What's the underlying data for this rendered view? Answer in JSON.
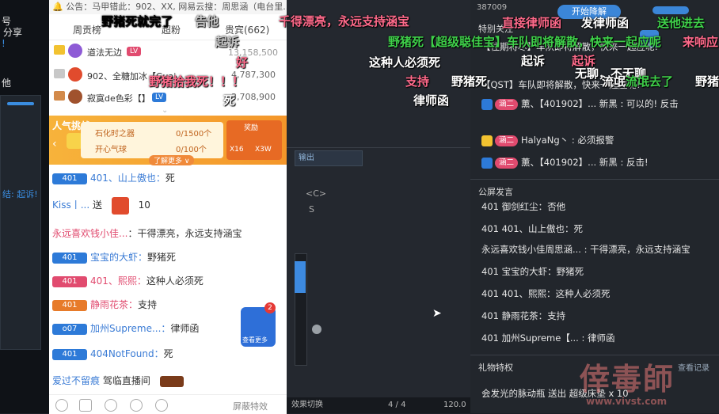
{
  "left_strip": {
    "texts": [
      "号",
      "分享",
      "他",
      "!"
    ],
    "tags": [
      "结: 起诉!"
    ]
  },
  "chat": {
    "notice": "公告：马甲错此：902、XX, 网易云搜：周思涵（电台里...",
    "tabs": [
      "周贡榜",
      "超粉",
      "贵宾(662)"
    ],
    "ranking": [
      {
        "name": "道法无边",
        "value": ""
      },
      {
        "name": "902、全糖加冰【Guai...",
        "value": "4,787,300"
      },
      {
        "name": "寂寞de色彩【】",
        "value": "3,708,900"
      }
    ],
    "first_value": "13,158,500",
    "banner": {
      "title": "人气挑战",
      "row1": "石化时之器",
      "row1_val": "0/1500个",
      "row2": "开心气球",
      "row2_val": "0/100个",
      "more": "了解更多 ∨",
      "reward": "奖励",
      "x1": "X16",
      "x2": "X3W"
    },
    "lines": [
      {
        "level": "401",
        "name": "401、山上傲也：",
        "text": "死"
      },
      {
        "name": "Kiss丨...",
        "text": "送",
        "extra": "10"
      },
      {
        "name": "永远喜欢钱小佳...",
        "text": "：干得漂亮，永远支持涵宝"
      },
      {
        "level": "401",
        "name": "宝宝的大虾：",
        "text": "野猪死"
      },
      {
        "level": "401",
        "name": "401、熙熙：",
        "text": "这种人必须死"
      },
      {
        "level": "401",
        "name": "静雨花茶：",
        "text": "支持"
      },
      {
        "level": "o07",
        "name": "加州Supreme...：",
        "text": "律师函"
      },
      {
        "level": "401",
        "name": "404NotFound：",
        "text": "死"
      },
      {
        "name": "爱过不留痕",
        "text": "驾临直播间"
      }
    ],
    "bottom": {
      "block": "屏蔽特效"
    },
    "float_badge": "2",
    "float_label": "查看更多"
  },
  "daw": {
    "header": "输出",
    "labels": [
      "<C>",
      "S"
    ],
    "footer_left": "效果切换",
    "counter": "4 / 4",
    "tempo": "120.0"
  },
  "right": {
    "top_values": "387009",
    "top_button": "开始降解",
    "section1": "特别关注",
    "special_lines": [
      "【住期将尽】车队即将解散，快来一起应呢!",
      "【QST】车队即将解散，快来一起应呢!",
      "薰、【401902】...  新黑  : 可以的! 反击",
      "HalyaNg丶 : 必须报警",
      "薰、【401902】...  新黑  : 反击!"
    ],
    "section2": "公屏发言",
    "public_lines": [
      "401 御剑红尘：否他",
      "401 401、山上傲也：死",
      "永远喜欢钱小佳周思涵... : 干得漂亮，永远支持涵宝",
      "401 宝宝的大虾：野猪死",
      "401 401、熙熙：这种人必须死",
      "401 静雨花茶：支持",
      "401 加州Supreme【... : 律师函"
    ],
    "section3": "礼物特权",
    "records": "查看记录",
    "gift_line": "会发光的脉动瓶 送出  超级床垫 x 10"
  },
  "danmaku": [
    {
      "t": "野猪死就完了",
      "c": "gr"
    },
    {
      "t": "告他",
      "c": "gr"
    },
    {
      "t": "起诉",
      "c": "gr"
    },
    {
      "t": "千得漂亮，永远支持涵宝",
      "c": "r"
    },
    {
      "t": "直接律师函",
      "c": "r"
    },
    {
      "t": "发律师函",
      "c": "w"
    },
    {
      "t": "送他进去",
      "c": "g"
    },
    {
      "t": "野猪死【超级聪佳宝】车队即将解散，快来一起应呢",
      "c": "g"
    },
    {
      "t": "好",
      "c": "r"
    },
    {
      "t": "这种人必须死",
      "c": "w"
    },
    {
      "t": "起诉",
      "c": "w"
    },
    {
      "t": "起诉",
      "c": "r"
    },
    {
      "t": "无聊，不无聊",
      "c": "w"
    },
    {
      "t": "野猪拾我死！！！",
      "c": "r"
    },
    {
      "t": "支持",
      "c": "r"
    },
    {
      "t": "野猪死",
      "c": "w"
    },
    {
      "t": "流氓",
      "c": "w"
    },
    {
      "t": "流氓去了",
      "c": "g"
    },
    {
      "t": "野猪",
      "c": "w"
    },
    {
      "t": "律师函",
      "c": "w"
    },
    {
      "t": "死",
      "c": "w"
    },
    {
      "t": "来响应",
      "c": "r"
    }
  ],
  "watermark": "倖毒師",
  "watermark_url": "www.vivst.com"
}
